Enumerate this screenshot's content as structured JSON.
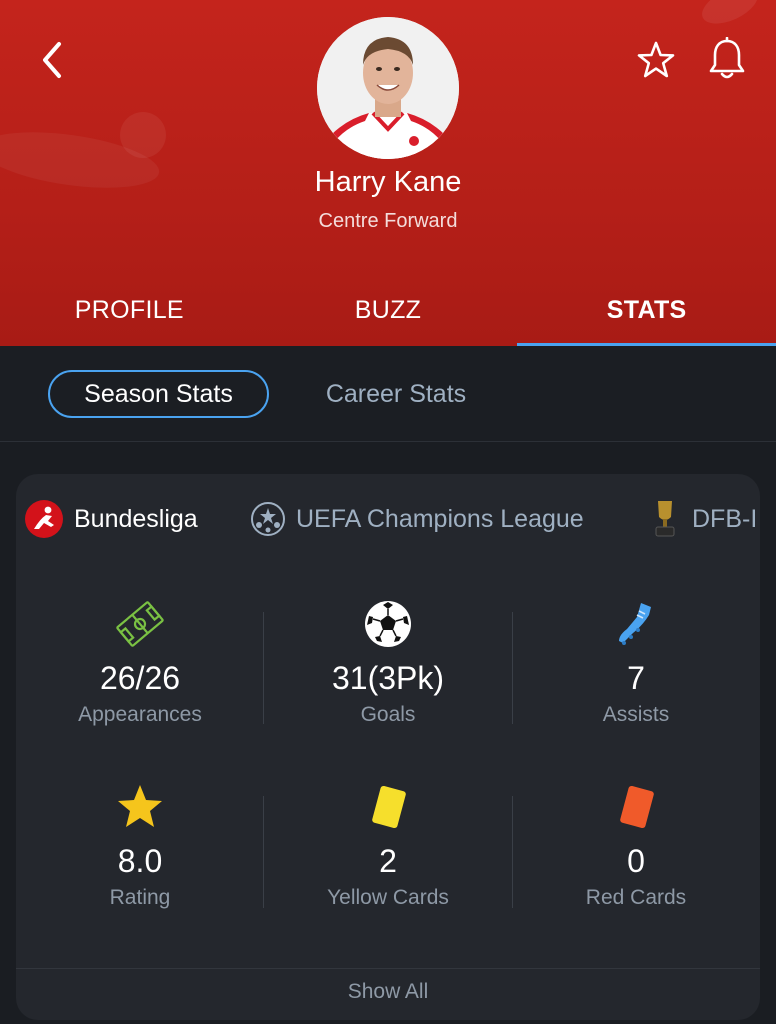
{
  "player": {
    "name": "Harry Kane",
    "position": "Centre Forward"
  },
  "header": {
    "back_icon": "chevron-left-icon",
    "favorite_icon": "star-outline-icon",
    "notify_icon": "bell-icon"
  },
  "tabs": [
    {
      "label": "PROFILE",
      "active": false
    },
    {
      "label": "BUZZ",
      "active": false
    },
    {
      "label": "STATS",
      "active": true
    }
  ],
  "stats_mode": {
    "options": [
      {
        "label": "Season Stats",
        "active": true
      },
      {
        "label": "Career Stats",
        "active": false
      }
    ]
  },
  "competitions": [
    {
      "label": "Bundesliga",
      "active": true,
      "icon": "bundesliga-logo-icon"
    },
    {
      "label": "UEFA Champions League",
      "active": false,
      "icon": "champions-league-logo-icon"
    },
    {
      "label": "DFB-I",
      "active": false,
      "icon": "dfb-pokal-trophy-icon"
    }
  ],
  "stats": [
    {
      "value": "26/26",
      "label": "Appearances",
      "icon": "pitch-icon"
    },
    {
      "value": "31(3Pk)",
      "label": "Goals",
      "icon": "football-icon"
    },
    {
      "value": "7",
      "label": "Assists",
      "icon": "boot-icon"
    },
    {
      "value": "8.0",
      "label": "Rating",
      "icon": "star-icon"
    },
    {
      "value": "2",
      "label": "Yellow Cards",
      "icon": "yellow-card-icon"
    },
    {
      "value": "0",
      "label": "Red Cards",
      "icon": "red-card-icon"
    }
  ],
  "footer": {
    "show_all_label": "Show All"
  },
  "colors": {
    "header_red": "#c4241c",
    "accent_blue": "#4aa3f0",
    "background": "#1a1d22",
    "card": "#24272d",
    "yellow_card": "#f6df2c",
    "red_card": "#f05a2a",
    "pitch_green": "#7ac143",
    "boot_blue": "#4aa3f0",
    "rating_star": "#f5c51c"
  }
}
